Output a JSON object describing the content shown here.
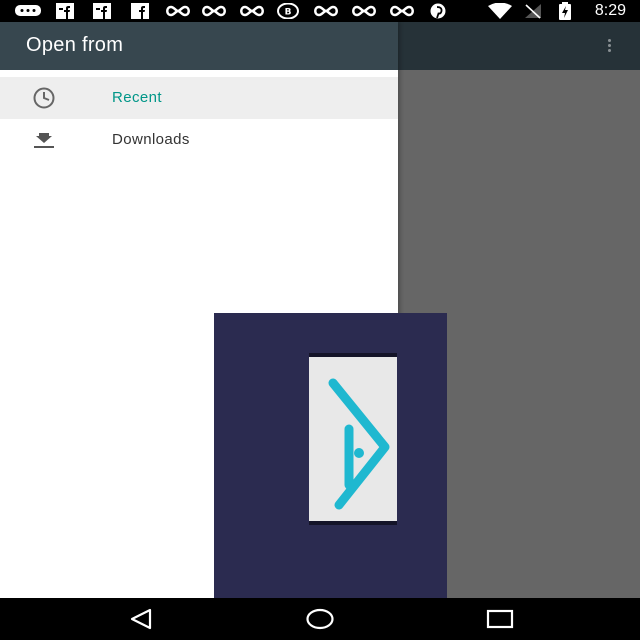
{
  "status_bar": {
    "notification_icons": [
      "chat-bubble-icon",
      "facebook-icon",
      "facebook-icon",
      "facebook-icon",
      "infinity-icon",
      "infinity-icon",
      "infinity-icon",
      "b-circle-icon",
      "infinity-icon",
      "infinity-icon",
      "infinity-icon",
      "pinterest-icon"
    ],
    "time": "8:29",
    "icons": [
      "wifi-icon",
      "no-signal-icon",
      "battery-charging-icon"
    ]
  },
  "app_bar": {
    "overflow_icon": "overflow-menu-icon"
  },
  "drawer": {
    "title": "Open from",
    "items": [
      {
        "label": "Recent",
        "icon": "clock-icon",
        "selected": true
      },
      {
        "label": "Downloads",
        "icon": "download-icon",
        "selected": false
      }
    ]
  },
  "overlay": {
    "logo": "app-logo-icon"
  },
  "nav_bar": {
    "buttons": [
      "back-icon",
      "home-icon",
      "recents-icon"
    ]
  },
  "colors": {
    "accent": "#009688",
    "drawer_header": "#37474f",
    "app_bar": "#263238",
    "scrim": "#666666",
    "overlay_bg": "#2b2b50",
    "logo_cyan": "#1fb8d0"
  }
}
